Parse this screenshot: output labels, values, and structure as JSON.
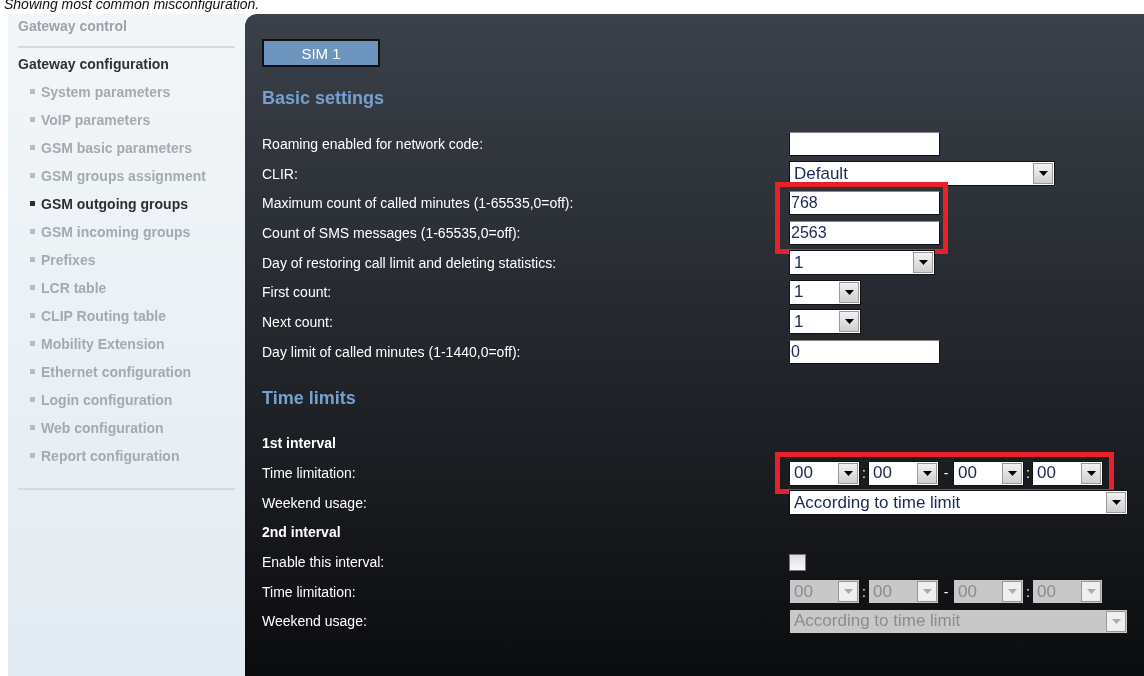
{
  "caption": "Showing most common misconfiguration.",
  "sidebar": {
    "section_title": "Gateway control",
    "group_title": "Gateway configuration",
    "items": [
      {
        "label": "System parameters",
        "selected": false
      },
      {
        "label": "VoIP parameters",
        "selected": false
      },
      {
        "label": "GSM basic parameters",
        "selected": false
      },
      {
        "label": "GSM groups assignment",
        "selected": false
      },
      {
        "label": "GSM outgoing groups",
        "selected": true
      },
      {
        "label": "GSM incoming groups",
        "selected": false
      },
      {
        "label": "Prefixes",
        "selected": false
      },
      {
        "label": "LCR table",
        "selected": false
      },
      {
        "label": "CLIP Routing table",
        "selected": false
      },
      {
        "label": "Mobility Extension",
        "selected": false
      },
      {
        "label": "Ethernet configuration",
        "selected": false
      },
      {
        "label": "Login configuration",
        "selected": false
      },
      {
        "label": "Web configuration",
        "selected": false
      },
      {
        "label": "Report configuration",
        "selected": false
      }
    ]
  },
  "tabs": [
    {
      "label": "SIM 1",
      "selected": true
    }
  ],
  "sections": [
    {
      "title": "Basic settings",
      "rows": [
        {
          "kind": "text",
          "label": "Roaming enabled for network code:"
        },
        {
          "kind": "select-wide",
          "label": "CLIR:",
          "value": "Default"
        },
        {
          "kind": "text",
          "label": "Maximum count of called minutes (1-65535,0=off):",
          "value": "768",
          "highlighted": true
        },
        {
          "kind": "text",
          "label": "Count of SMS messages (1-65535,0=off):",
          "value": "2563",
          "highlighted": true
        },
        {
          "kind": "select-medium",
          "label": "Day of restoring call limit and deleting statistics:",
          "value": "1"
        },
        {
          "kind": "select-narrow",
          "label": "First count:",
          "value": "1"
        },
        {
          "kind": "select-narrow",
          "label": "Next count:",
          "value": "1"
        },
        {
          "kind": "text",
          "label": "Day limit of called minutes (1-1440,0=off):",
          "value": "0"
        }
      ]
    },
    {
      "title": "Time limits",
      "rows": [
        {
          "kind": "subheading",
          "label": "1st interval"
        },
        {
          "kind": "time",
          "label": "Time limitation:",
          "values": [
            "00",
            "00",
            "00",
            "00"
          ],
          "separators": [
            ":",
            "-",
            ":"
          ],
          "disabled": false,
          "highlighted": true
        },
        {
          "kind": "select-full",
          "label": "Weekend usage:",
          "value": "According to time limit",
          "disabled": false
        },
        {
          "kind": "subheading",
          "label": "2nd interval"
        },
        {
          "kind": "checkbox",
          "label": "Enable this interval:",
          "checked": false
        },
        {
          "kind": "time",
          "label": "Time limitation:",
          "values": [
            "00",
            "00",
            "00",
            "00"
          ],
          "separators": [
            ":",
            "-",
            ":"
          ],
          "disabled": true
        },
        {
          "kind": "select-full",
          "label": "Weekend usage:",
          "value": "According to time limit",
          "disabled": true
        }
      ]
    }
  ]
}
